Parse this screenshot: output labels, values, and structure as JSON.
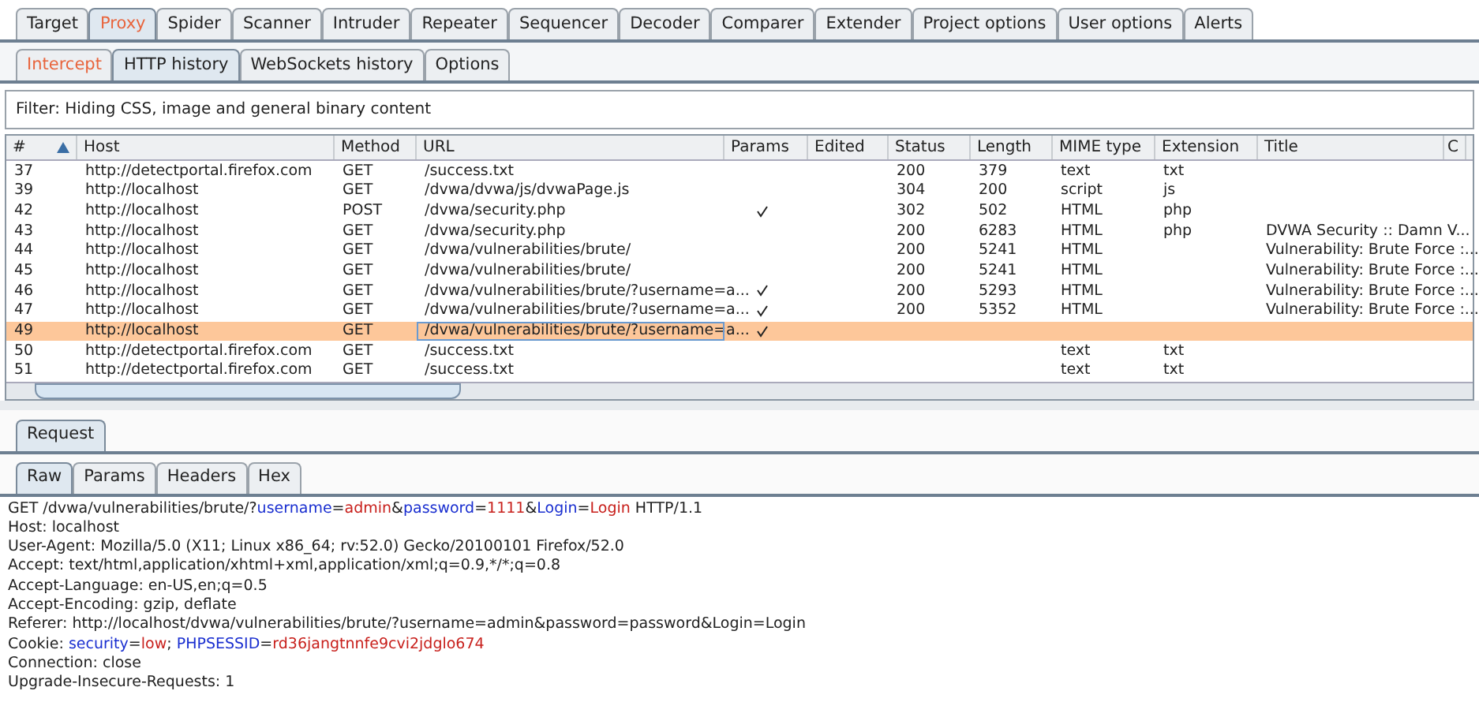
{
  "main_tabs": [
    {
      "label": "Target",
      "selected": false,
      "highlighted": false
    },
    {
      "label": "Proxy",
      "selected": true,
      "highlighted": true
    },
    {
      "label": "Spider",
      "selected": false,
      "highlighted": false
    },
    {
      "label": "Scanner",
      "selected": false,
      "highlighted": false
    },
    {
      "label": "Intruder",
      "selected": false,
      "highlighted": false
    },
    {
      "label": "Repeater",
      "selected": false,
      "highlighted": false
    },
    {
      "label": "Sequencer",
      "selected": false,
      "highlighted": false
    },
    {
      "label": "Decoder",
      "selected": false,
      "highlighted": false
    },
    {
      "label": "Comparer",
      "selected": false,
      "highlighted": false
    },
    {
      "label": "Extender",
      "selected": false,
      "highlighted": false
    },
    {
      "label": "Project options",
      "selected": false,
      "highlighted": false
    },
    {
      "label": "User options",
      "selected": false,
      "highlighted": false
    },
    {
      "label": "Alerts",
      "selected": false,
      "highlighted": false
    }
  ],
  "sub_tabs": [
    {
      "label": "Intercept",
      "selected": false,
      "highlighted": true
    },
    {
      "label": "HTTP history",
      "selected": true,
      "highlighted": false
    },
    {
      "label": "WebSockets history",
      "selected": false,
      "highlighted": false
    },
    {
      "label": "Options",
      "selected": false,
      "highlighted": false
    }
  ],
  "filter": "Filter: Hiding CSS, image and general binary content",
  "table": {
    "columns": [
      {
        "label": "#",
        "sorted": true
      },
      {
        "label": "Host",
        "sorted": false
      },
      {
        "label": "Method",
        "sorted": false
      },
      {
        "label": "URL",
        "sorted": false
      },
      {
        "label": "Params",
        "sorted": false
      },
      {
        "label": "Edited",
        "sorted": false
      },
      {
        "label": "Status",
        "sorted": false
      },
      {
        "label": "Length",
        "sorted": false
      },
      {
        "label": "MIME type",
        "sorted": false
      },
      {
        "label": "Extension",
        "sorted": false
      },
      {
        "label": "Title",
        "sorted": false
      },
      {
        "label": "C",
        "sorted": false
      }
    ],
    "rows": [
      {
        "selected": false,
        "num": "37",
        "host": "http://detectportal.firefox.com",
        "method": "GET",
        "url": "/success.txt",
        "params": false,
        "status": "200",
        "length": "379",
        "mime": "text",
        "ext": "txt",
        "title": ""
      },
      {
        "selected": false,
        "num": "39",
        "host": "http://localhost",
        "method": "GET",
        "url": "/dvwa/dvwa/js/dvwaPage.js",
        "params": false,
        "status": "304",
        "length": "200",
        "mime": "script",
        "ext": "js",
        "title": ""
      },
      {
        "selected": false,
        "num": "42",
        "host": "http://localhost",
        "method": "POST",
        "url": "/dvwa/security.php",
        "params": true,
        "status": "302",
        "length": "502",
        "mime": "HTML",
        "ext": "php",
        "title": ""
      },
      {
        "selected": false,
        "num": "43",
        "host": "http://localhost",
        "method": "GET",
        "url": "/dvwa/security.php",
        "params": false,
        "status": "200",
        "length": "6283",
        "mime": "HTML",
        "ext": "php",
        "title": "DVWA Security :: Damn V..."
      },
      {
        "selected": false,
        "num": "44",
        "host": "http://localhost",
        "method": "GET",
        "url": "/dvwa/vulnerabilities/brute/",
        "params": false,
        "status": "200",
        "length": "5241",
        "mime": "HTML",
        "ext": "",
        "title": "Vulnerability: Brute Force :..."
      },
      {
        "selected": false,
        "num": "45",
        "host": "http://localhost",
        "method": "GET",
        "url": "/dvwa/vulnerabilities/brute/",
        "params": false,
        "status": "200",
        "length": "5241",
        "mime": "HTML",
        "ext": "",
        "title": "Vulnerability: Brute Force :..."
      },
      {
        "selected": false,
        "num": "46",
        "host": "http://localhost",
        "method": "GET",
        "url": "/dvwa/vulnerabilities/brute/?username=a...",
        "params": true,
        "status": "200",
        "length": "5293",
        "mime": "HTML",
        "ext": "",
        "title": "Vulnerability: Brute Force :..."
      },
      {
        "selected": false,
        "num": "47",
        "host": "http://localhost",
        "method": "GET",
        "url": "/dvwa/vulnerabilities/brute/?username=a...",
        "params": true,
        "status": "200",
        "length": "5352",
        "mime": "HTML",
        "ext": "",
        "title": "Vulnerability: Brute Force :..."
      },
      {
        "selected": true,
        "num": "49",
        "host": "http://localhost",
        "method": "GET",
        "url": "/dvwa/vulnerabilities/brute/?username=a...",
        "params": true,
        "status": "",
        "length": "",
        "mime": "",
        "ext": "",
        "title": ""
      },
      {
        "selected": false,
        "num": "50",
        "host": "http://detectportal.firefox.com",
        "method": "GET",
        "url": "/success.txt",
        "params": false,
        "status": "",
        "length": "",
        "mime": "text",
        "ext": "txt",
        "title": ""
      },
      {
        "selected": false,
        "num": "51",
        "host": "http://detectportal.firefox.com",
        "method": "GET",
        "url": "/success.txt",
        "params": false,
        "status": "",
        "length": "",
        "mime": "text",
        "ext": "txt",
        "title": ""
      }
    ]
  },
  "message_tabs": [
    {
      "label": "Request",
      "selected": true
    }
  ],
  "view_tabs": [
    {
      "label": "Raw",
      "selected": true
    },
    {
      "label": "Params",
      "selected": false
    },
    {
      "label": "Headers",
      "selected": false
    },
    {
      "label": "Hex",
      "selected": false
    }
  ],
  "request_lines": [
    [
      {
        "kind": "plain",
        "text": "GET /dvwa/vulnerabilities/brute/?"
      },
      {
        "kind": "name",
        "text": "username"
      },
      {
        "kind": "plain",
        "text": "="
      },
      {
        "kind": "value",
        "text": "admin"
      },
      {
        "kind": "plain",
        "text": "&"
      },
      {
        "kind": "name",
        "text": "password"
      },
      {
        "kind": "plain",
        "text": "="
      },
      {
        "kind": "value",
        "text": "1111"
      },
      {
        "kind": "plain",
        "text": "&"
      },
      {
        "kind": "name",
        "text": "Login"
      },
      {
        "kind": "plain",
        "text": "="
      },
      {
        "kind": "value",
        "text": "Login"
      },
      {
        "kind": "plain",
        "text": " HTTP/1.1"
      }
    ],
    [
      {
        "kind": "plain",
        "text": "Host: localhost"
      }
    ],
    [
      {
        "kind": "plain",
        "text": "User-Agent: Mozilla/5.0 (X11; Linux x86_64; rv:52.0) Gecko/20100101 Firefox/52.0"
      }
    ],
    [
      {
        "kind": "plain",
        "text": "Accept: text/html,application/xhtml+xml,application/xml;q=0.9,*/*;q=0.8"
      }
    ],
    [
      {
        "kind": "plain",
        "text": "Accept-Language: en-US,en;q=0.5"
      }
    ],
    [
      {
        "kind": "plain",
        "text": "Accept-Encoding: gzip, deflate"
      }
    ],
    [
      {
        "kind": "plain",
        "text": "Referer: http://localhost/dvwa/vulnerabilities/brute/?username=admin&password=password&Login=Login"
      }
    ],
    [
      {
        "kind": "plain",
        "text": "Cookie: "
      },
      {
        "kind": "name",
        "text": "security"
      },
      {
        "kind": "plain",
        "text": "="
      },
      {
        "kind": "value",
        "text": "low"
      },
      {
        "kind": "plain",
        "text": "; "
      },
      {
        "kind": "name",
        "text": "PHPSESSID"
      },
      {
        "kind": "plain",
        "text": "="
      },
      {
        "kind": "value",
        "text": "rd36jangtnnfe9cvi2jdglo674"
      }
    ],
    [
      {
        "kind": "plain",
        "text": "Connection: close"
      }
    ],
    [
      {
        "kind": "plain",
        "text": "Upgrade-Insecure-Requests: 1"
      }
    ]
  ]
}
